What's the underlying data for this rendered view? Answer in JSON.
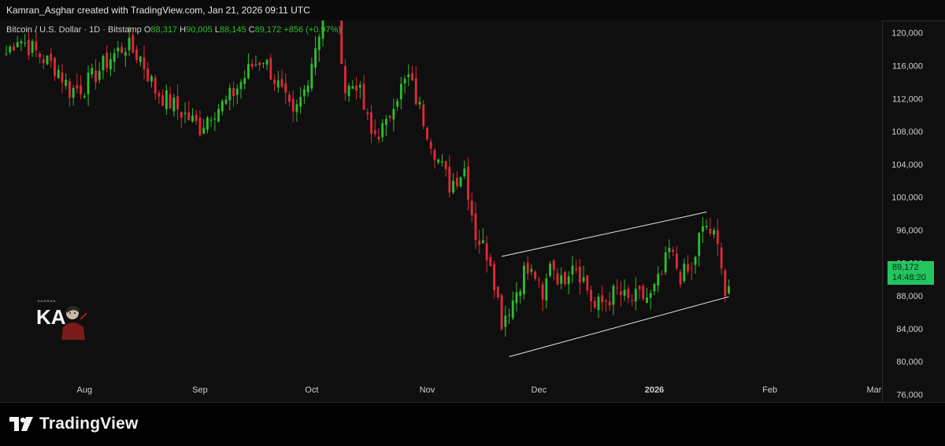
{
  "header": {
    "text": "Kamran_Asghar created with TradingView.com, Jan 21, 2026 09:11 UTC"
  },
  "legend": {
    "symbol": "Bitcoin / U.S. Dollar · 1D · Bitstamp",
    "o_label": "O",
    "o": "88,317",
    "h_label": "H",
    "h": "90,005",
    "l_label": "L",
    "l": "88,145",
    "c_label": "C",
    "c": "89,172",
    "change": "+856 (+0.97%)"
  },
  "price_box": {
    "price": "89,172",
    "countdown": "14:48:20"
  },
  "brand": {
    "name": "TradingView",
    "logo_text": "KA"
  },
  "colors": {
    "up": "#2ebd2e",
    "down": "#e0293a",
    "background": "#0f0f0f",
    "price_label": "#22c55e"
  },
  "chart_data": {
    "type": "candlestick",
    "y_axis": {
      "ticks": [
        76000,
        80000,
        84000,
        88000,
        92000,
        96000,
        100000,
        104000,
        108000,
        112000,
        116000,
        120000
      ],
      "tick_labels": [
        "76,000",
        "80,000",
        "84,000",
        "88,000",
        "92,000",
        "96,000",
        "100,000",
        "104,000",
        "108,000",
        "112,000",
        "116,000",
        "120,000"
      ],
      "range": [
        75000,
        121500
      ]
    },
    "x_axis": {
      "labels": [
        "Aug",
        "Sep",
        "Oct",
        "Nov",
        "Dec",
        "2026",
        "Feb",
        "Mar"
      ],
      "label_dates": [
        "2025-08-01",
        "2025-09-01",
        "2025-10-01",
        "2025-11-01",
        "2025-12-01",
        "2026-01-01",
        "2026-02-01",
        "2026-03-01"
      ],
      "range": [
        "2025-07-11",
        "2026-03-01"
      ]
    },
    "close_path": [
      [
        "2025-07-11",
        117500
      ],
      [
        "2025-07-14",
        119500
      ],
      [
        "2025-07-18",
        118000
      ],
      [
        "2025-07-22",
        116500
      ],
      [
        "2025-07-25",
        115500
      ],
      [
        "2025-07-28",
        113000
      ],
      [
        "2025-08-01",
        113500
      ],
      [
        "2025-08-04",
        115000
      ],
      [
        "2025-08-08",
        117000
      ],
      [
        "2025-08-12",
        118500
      ],
      [
        "2025-08-16",
        117000
      ],
      [
        "2025-08-20",
        113000
      ],
      [
        "2025-08-24",
        111500
      ],
      [
        "2025-08-28",
        110000
      ],
      [
        "2025-09-01",
        108500
      ],
      [
        "2025-09-04",
        110500
      ],
      [
        "2025-09-08",
        111500
      ],
      [
        "2025-09-12",
        114000
      ],
      [
        "2025-09-15",
        116000
      ],
      [
        "2025-09-18",
        117000
      ],
      [
        "2025-09-22",
        113500
      ],
      [
        "2025-09-26",
        109500
      ],
      [
        "2025-09-29",
        113000
      ],
      [
        "2025-10-02",
        118500
      ],
      [
        "2025-10-04",
        122000
      ],
      [
        "2025-10-06",
        124500
      ],
      [
        "2025-10-08",
        122000
      ],
      [
        "2025-10-10",
        113000
      ],
      [
        "2025-10-13",
        114000
      ],
      [
        "2025-10-17",
        107500
      ],
      [
        "2025-10-21",
        108500
      ],
      [
        "2025-10-23",
        112000
      ],
      [
        "2025-10-27",
        114500
      ],
      [
        "2025-10-31",
        109500
      ],
      [
        "2025-11-04",
        104500
      ],
      [
        "2025-11-07",
        101500
      ],
      [
        "2025-11-11",
        103500
      ],
      [
        "2025-11-14",
        95500
      ],
      [
        "2025-11-18",
        92500
      ],
      [
        "2025-11-21",
        85000
      ],
      [
        "2025-11-24",
        87500
      ],
      [
        "2025-11-27",
        91000
      ],
      [
        "2025-11-30",
        90500
      ],
      [
        "2025-12-02",
        87000
      ],
      [
        "2025-12-04",
        92500
      ],
      [
        "2025-12-07",
        89500
      ],
      [
        "2025-12-10",
        92500
      ],
      [
        "2025-12-13",
        90000
      ],
      [
        "2025-12-16",
        86500
      ],
      [
        "2025-12-19",
        87500
      ],
      [
        "2025-12-22",
        88500
      ],
      [
        "2025-12-25",
        87300
      ],
      [
        "2025-12-28",
        87800
      ],
      [
        "2025-12-31",
        87800
      ],
      [
        "2026-01-03",
        90500
      ],
      [
        "2026-01-05",
        93500
      ],
      [
        "2026-01-08",
        90500
      ],
      [
        "2026-01-11",
        91000
      ],
      [
        "2026-01-13",
        95000
      ],
      [
        "2026-01-15",
        96500
      ],
      [
        "2026-01-17",
        95000
      ],
      [
        "2026-01-19",
        92500
      ],
      [
        "2026-01-20",
        88300
      ],
      [
        "2026-01-21",
        89172
      ]
    ],
    "channel": {
      "upper": [
        [
          "2025-11-21",
          92800
        ],
        [
          "2026-01-15",
          98200
        ]
      ],
      "lower": [
        [
          "2025-11-23",
          80600
        ],
        [
          "2026-01-21",
          87900
        ]
      ]
    },
    "last": {
      "open": 88317,
      "high": 90005,
      "low": 88145,
      "close": 89172
    }
  }
}
